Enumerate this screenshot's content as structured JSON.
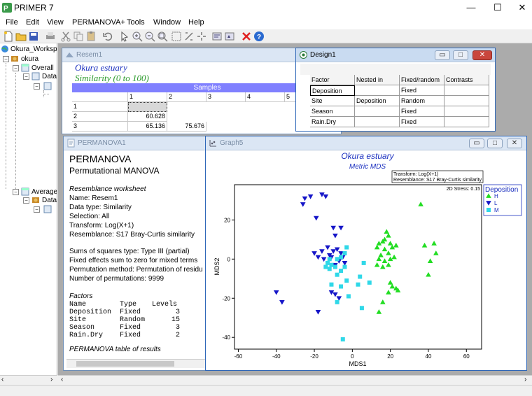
{
  "app": {
    "title": "PRIMER 7",
    "controls": {
      "minimize": "—",
      "maximize": "☐",
      "close": "✕"
    }
  },
  "menu": [
    "File",
    "Edit",
    "View",
    "PERMANOVA+",
    "Tools",
    "Window",
    "Help"
  ],
  "tree": {
    "items": [
      {
        "label": "Okura_Workspa",
        "icon": "globe-icon"
      },
      {
        "label": "okura",
        "icon": "workbook-icon"
      },
      {
        "label": "Overall ",
        "icon": "sheet-icon"
      },
      {
        "label": "Data",
        "icon": "sheet-icon"
      },
      {
        "label": "Average",
        "icon": "workbook-icon"
      },
      {
        "label": "Data",
        "icon": "sheet-icon"
      }
    ]
  },
  "resem": {
    "window_title": "Resem1",
    "title": "Okura estuary",
    "subtitle": "Similarity (0 to 100)",
    "samples_label": "Samples",
    "col_headers": [
      "1",
      "2",
      "3",
      "4",
      "5"
    ],
    "rows": [
      {
        "label": "1",
        "cells": [
          "",
          ""
        ]
      },
      {
        "label": "2",
        "cells": [
          "60.628",
          ""
        ]
      },
      {
        "label": "3",
        "cells": [
          "65.136",
          "75.676"
        ]
      }
    ]
  },
  "design": {
    "window_title": "Design1",
    "headers": [
      "Factor",
      "Nested in",
      "Fixed/random",
      "Contrasts"
    ],
    "rows": [
      [
        "Deposition",
        "",
        "Fixed",
        ""
      ],
      [
        "Site",
        "Deposition",
        "Random",
        ""
      ],
      [
        "Season",
        "",
        "Fixed",
        ""
      ],
      [
        "Rain.Dry",
        "",
        "Fixed",
        ""
      ]
    ]
  },
  "permanova": {
    "window_title": "PERMANOVA1",
    "heading": "PERMANOVA",
    "subheading": "Permutational MANOVA",
    "section1_title": "Resemblance worksheet",
    "section1_lines": [
      "Name: Resem1",
      "Data type: Similarity",
      "Selection: All",
      "Transform: Log(X+1)",
      "Resemblance: S17 Bray-Curtis similarity"
    ],
    "section2_lines": [
      "Sums of squares type: Type III (partial)",
      "Fixed effects sum to zero for mixed terms",
      "Permutation method: Permutation of residu",
      "Number of permutations: 9999"
    ],
    "factors_title": "Factors",
    "factors_header": [
      "Name",
      "Type",
      "Levels"
    ],
    "factors": [
      [
        "Deposition",
        "Fixed",
        "3"
      ],
      [
        "Site",
        "Random",
        "15"
      ],
      [
        "Season",
        "Fixed",
        "3"
      ],
      [
        "Rain.Dry",
        "Fixed",
        "2"
      ]
    ],
    "table_title": "PERMANOVA table of results"
  },
  "graph": {
    "window_title": "Graph5",
    "colors": {
      "H": "#22dd22",
      "L": "#1616c8",
      "M": "#30d8e8"
    }
  },
  "chart_data": {
    "type": "scatter",
    "title": "Okura estuary",
    "subtitle": "Metric MDS",
    "xlabel": "MDS1",
    "ylabel": "MDS2",
    "xlim": [
      -62,
      68
    ],
    "ylim": [
      -46,
      38
    ],
    "xticks": [
      -60,
      -40,
      -20,
      0,
      20,
      40,
      60
    ],
    "yticks": [
      20,
      0,
      -20,
      -40
    ],
    "stress_label": "2D Stress: 0.15",
    "info_lines": [
      "Transform: Log(X+1)",
      "Resemblance: S17 Bray-Curtis similarity"
    ],
    "legend_title": "Deposition",
    "legend_position": "right",
    "series": [
      {
        "name": "H",
        "marker": "triangle-up",
        "color": "#22dd22",
        "points": [
          [
            36,
            28
          ],
          [
            18,
            14
          ],
          [
            19,
            12
          ],
          [
            17,
            10
          ],
          [
            16,
            9
          ],
          [
            14,
            8
          ],
          [
            13,
            6
          ],
          [
            20,
            8
          ],
          [
            21,
            6
          ],
          [
            23,
            7
          ],
          [
            17,
            5
          ],
          [
            19,
            3
          ],
          [
            15,
            2
          ],
          [
            14,
            0
          ],
          [
            17,
            -1
          ],
          [
            20,
            0
          ],
          [
            22,
            1
          ],
          [
            19,
            -3
          ],
          [
            16,
            -4
          ],
          [
            13,
            -3
          ],
          [
            20,
            -12
          ],
          [
            21,
            -14
          ],
          [
            23,
            -15
          ],
          [
            24,
            -16
          ],
          [
            19,
            -17
          ],
          [
            16,
            -22
          ],
          [
            14,
            -27
          ],
          [
            38,
            7
          ],
          [
            43,
            8
          ],
          [
            44,
            3
          ],
          [
            41,
            -1
          ],
          [
            40,
            -8
          ]
        ]
      },
      {
        "name": "L",
        "marker": "triangle-down",
        "color": "#1616c8",
        "points": [
          [
            -25,
            31
          ],
          [
            -22,
            32
          ],
          [
            -16,
            33
          ],
          [
            -14,
            32
          ],
          [
            -26,
            28
          ],
          [
            -19,
            21
          ],
          [
            -10,
            16
          ],
          [
            -6,
            16
          ],
          [
            -9,
            12
          ],
          [
            -13,
            6
          ],
          [
            -16,
            4
          ],
          [
            -20,
            3
          ],
          [
            -18,
            1
          ],
          [
            -15,
            0
          ],
          [
            -12,
            2
          ],
          [
            -10,
            4
          ],
          [
            -8,
            5
          ],
          [
            -6,
            3
          ],
          [
            -5,
            1
          ],
          [
            -4,
            -2
          ],
          [
            -7,
            -1
          ],
          [
            -9,
            -3
          ],
          [
            -11,
            1
          ],
          [
            -40,
            -17
          ],
          [
            -37,
            -22
          ],
          [
            -18,
            -27
          ],
          [
            -11,
            -17
          ],
          [
            -9,
            -18
          ],
          [
            -7,
            -20
          ]
        ]
      },
      {
        "name": "M",
        "marker": "square",
        "color": "#30d8e8",
        "points": [
          [
            -3,
            6
          ],
          [
            -4,
            3
          ],
          [
            -6,
            1
          ],
          [
            -8,
            0
          ],
          [
            -12,
            0
          ],
          [
            -13,
            -2
          ],
          [
            -11,
            -3
          ],
          [
            -14,
            -4
          ],
          [
            -12,
            -5
          ],
          [
            -9,
            -4
          ],
          [
            -6,
            -6
          ],
          [
            -4,
            -4
          ],
          [
            -8,
            -8
          ],
          [
            -3,
            -11
          ],
          [
            -11,
            -13
          ],
          [
            -6,
            -14
          ],
          [
            6,
            -2
          ],
          [
            4,
            -9
          ],
          [
            9,
            -12
          ],
          [
            3,
            -13
          ],
          [
            -2,
            -19
          ],
          [
            -8,
            -22
          ],
          [
            5,
            -25
          ],
          [
            -5,
            -41
          ]
        ]
      }
    ]
  }
}
